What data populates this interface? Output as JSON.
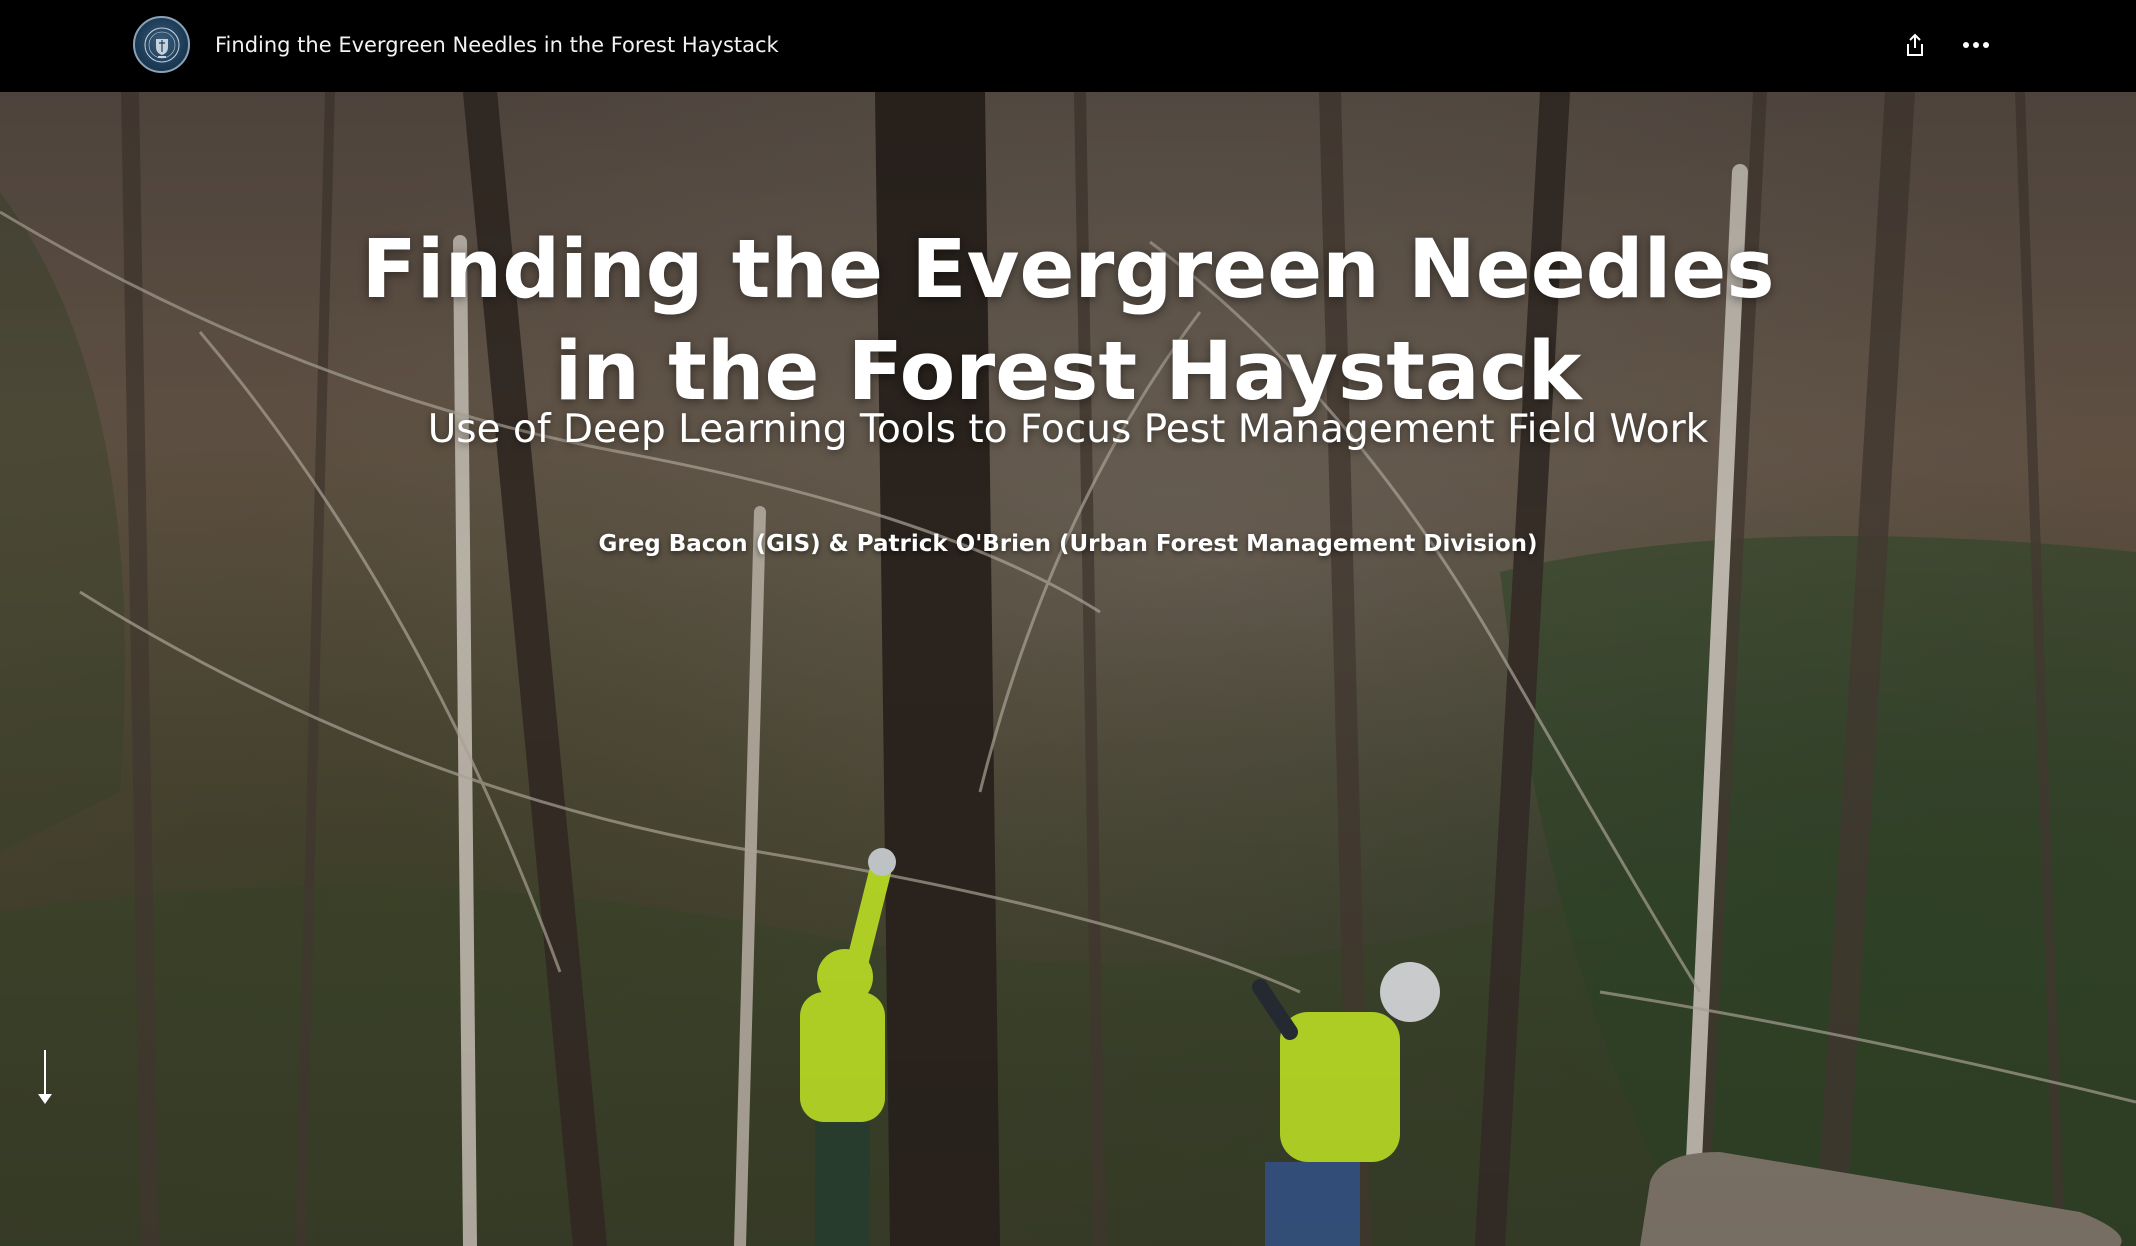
{
  "header": {
    "logo_name": "county-seal-logo",
    "title": "Finding the Evergreen Needles in the Forest Haystack",
    "share_icon": "share-icon",
    "more_icon": "more-options-icon"
  },
  "hero": {
    "title_line1": "Finding the Evergreen Needles",
    "title_line2": "in the Forest Haystack",
    "subtitle": "Use of Deep Learning Tools to Focus Pest Management Field Work",
    "byline": "Greg Bacon (GIS) & Patrick O'Brien (Urban Forest Management Division)",
    "scroll_icon": "arrow-down-icon"
  },
  "colors": {
    "topbar_bg": "#000000",
    "text": "#ffffff",
    "safety_vest": "#c8ec2a"
  }
}
